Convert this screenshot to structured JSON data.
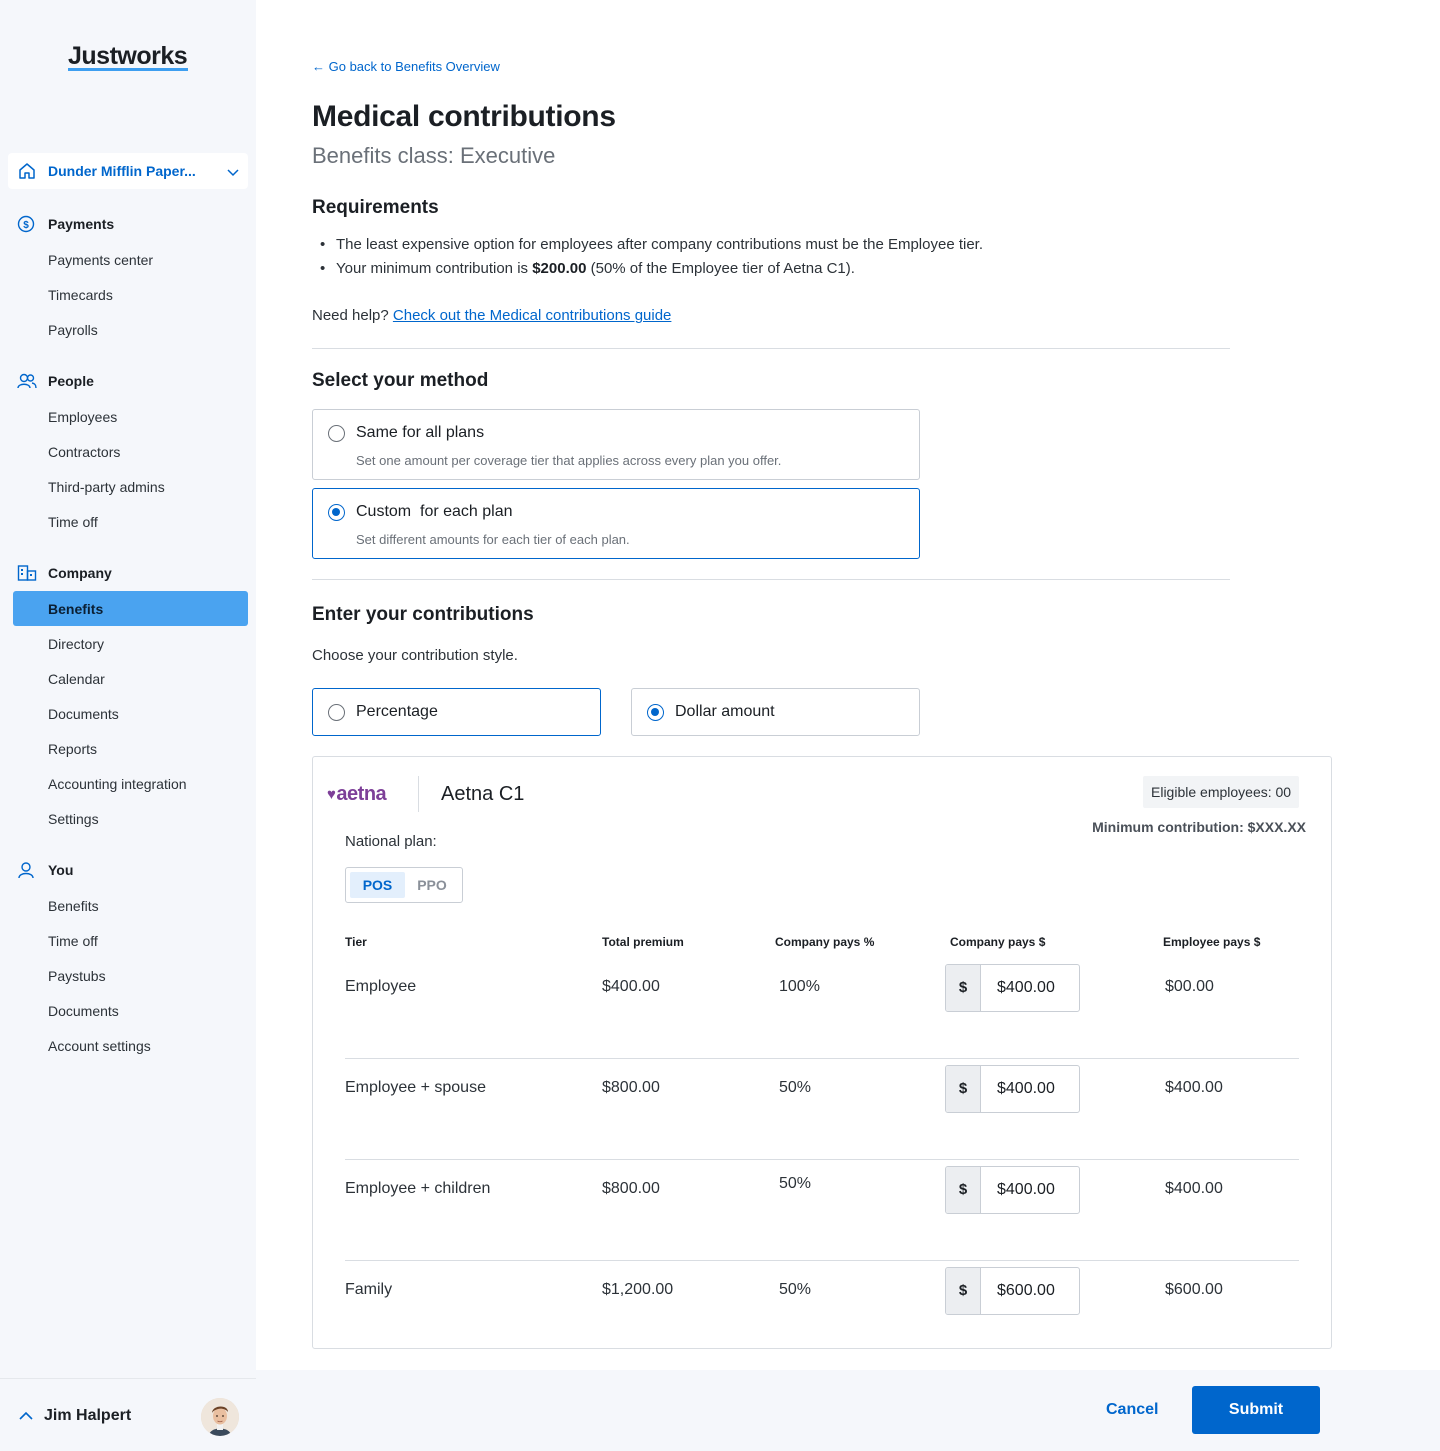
{
  "brand": {
    "logo": "Justworks",
    "accent": "#0066cc",
    "highlight": "#4aa3f0"
  },
  "sidebar": {
    "company": "Dunder Mifflin Paper...",
    "sections": [
      {
        "label": "Payments",
        "icon": "dollar-circle-icon",
        "items": [
          "Payments center",
          "Timecards",
          "Payrolls"
        ]
      },
      {
        "label": "People",
        "icon": "people-icon",
        "items": [
          "Employees",
          "Contractors",
          "Third-party admins",
          "Time off"
        ]
      },
      {
        "label": "Company",
        "icon": "building-icon",
        "items": [
          "Benefits",
          "Directory",
          "Calendar",
          "Documents",
          "Reports",
          "Accounting integration",
          "Settings"
        ],
        "active": "Benefits"
      },
      {
        "label": "You",
        "icon": "person-icon",
        "items": [
          "Benefits",
          "Time off",
          "Paystubs",
          "Documents",
          "Account settings"
        ]
      }
    ],
    "user": "Jim Halpert"
  },
  "main": {
    "back_link": "← Go back to Benefits Overview",
    "title": "Medical contributions",
    "subtitle": "Benefits class: Executive",
    "requirements": {
      "heading": "Requirements",
      "bullet1": "The least expensive option for employees after company contributions must be the Employee tier.",
      "bullet2_prefix": "Your minimum contribution is ",
      "bullet2_amount": "$200.00",
      "bullet2_suffix": " (50% of the Employee tier of Aetna C1)."
    },
    "help": {
      "prefix": "Need help? ",
      "link": "Check out the Medical contributions guide"
    },
    "method": {
      "heading": "Select your method",
      "options": [
        {
          "title": "Same for all plans",
          "desc": "Set one amount per coverage tier that applies across every plan you offer.",
          "selected": false
        },
        {
          "title": "Custom  for each plan",
          "desc": "Set different amounts for each tier of each plan.",
          "selected": true
        }
      ]
    },
    "contributions": {
      "heading": "Enter your contributions",
      "prompt": "Choose your contribution style.",
      "styles": [
        {
          "title": "Percentage",
          "selected": false
        },
        {
          "title": "Dollar amount",
          "selected": true
        }
      ]
    },
    "plan": {
      "carrier": "aetna",
      "name": "Aetna C1",
      "eligible": "Eligible employees: 00",
      "minimum": "Minimum contribution: $XXX.XX",
      "national_label": "National plan:",
      "network_options": [
        "POS",
        "PPO"
      ],
      "network_selected": "POS",
      "columns": [
        "Tier",
        "Total premium",
        "Company pays %",
        "Company pays $",
        "Employee pays $"
      ],
      "currency_symbol": "$",
      "rows": [
        {
          "tier": "Employee",
          "total": "$400.00",
          "pct": "100%",
          "company": "$400.00",
          "employee": "$00.00"
        },
        {
          "tier": "Employee + spouse",
          "total": "$800.00",
          "pct": "50%",
          "company": "$400.00",
          "employee": "$400.00"
        },
        {
          "tier": "Employee + children",
          "total": "$800.00",
          "pct": "50%",
          "company": "$400.00",
          "employee": "$400.00"
        },
        {
          "tier": "Family",
          "total": "$1,200.00",
          "pct": "50%",
          "company": "$600.00",
          "employee": "$600.00"
        }
      ]
    }
  },
  "footer": {
    "cancel": "Cancel",
    "submit": "Submit"
  }
}
